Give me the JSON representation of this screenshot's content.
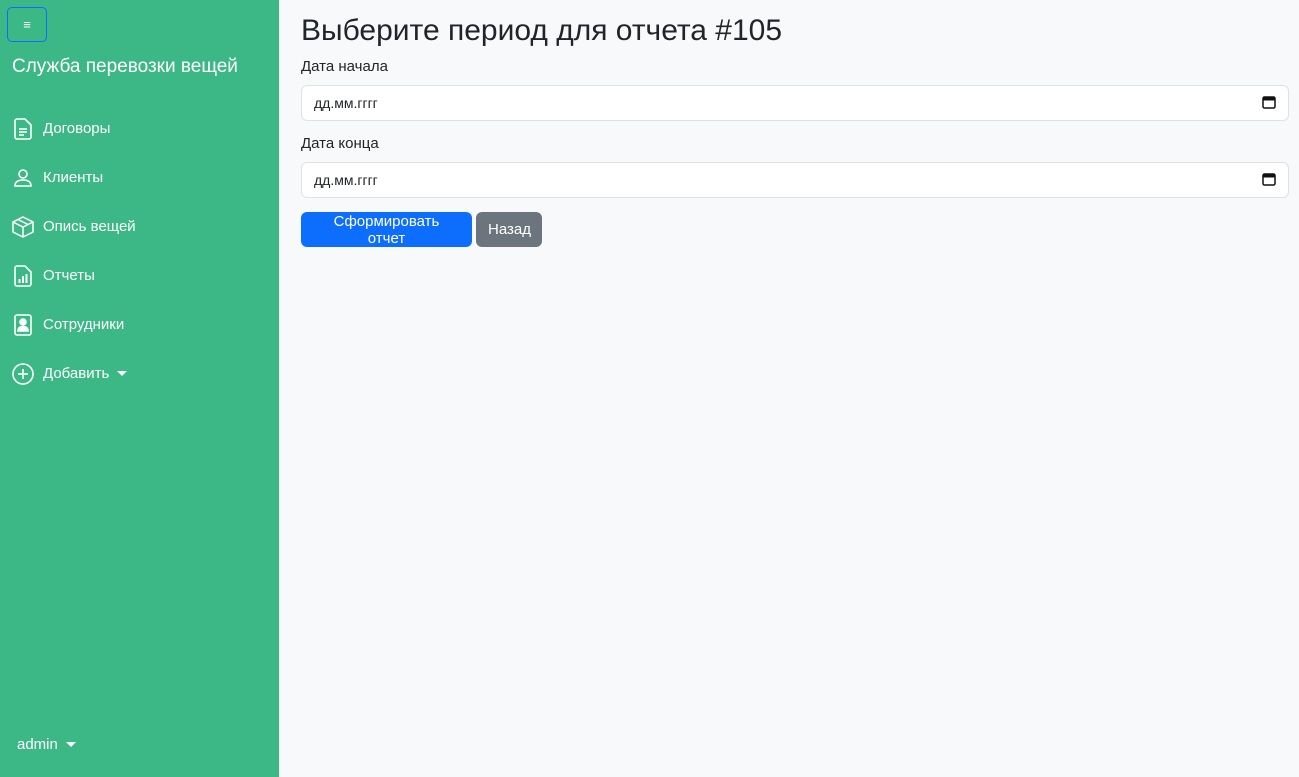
{
  "sidebar": {
    "toggle_label": "≡",
    "brand": "Служба перевозки вещей",
    "items": [
      {
        "label": "Договоры",
        "icon": "document-icon"
      },
      {
        "label": "Клиенты",
        "icon": "person-icon"
      },
      {
        "label": "Опись вещей",
        "icon": "box-icon"
      },
      {
        "label": "Отчеты",
        "icon": "report-icon"
      },
      {
        "label": "Сотрудники",
        "icon": "badge-icon"
      },
      {
        "label": "Добавить",
        "icon": "plus-circle-icon"
      }
    ],
    "user": "admin"
  },
  "main": {
    "title": "Выберите период для отчета #105",
    "start_label": "Дата начала",
    "start_value": "дд.мм.гггг",
    "end_label": "Дата конца",
    "end_value": "дд.мм.гггг",
    "submit_label": "Сформировать отчет",
    "back_label": "Назад"
  },
  "colors": {
    "sidebar_bg": "#3cb886",
    "primary": "#0d6efd",
    "secondary": "#6c757d",
    "page_bg": "#f8f9fa"
  }
}
